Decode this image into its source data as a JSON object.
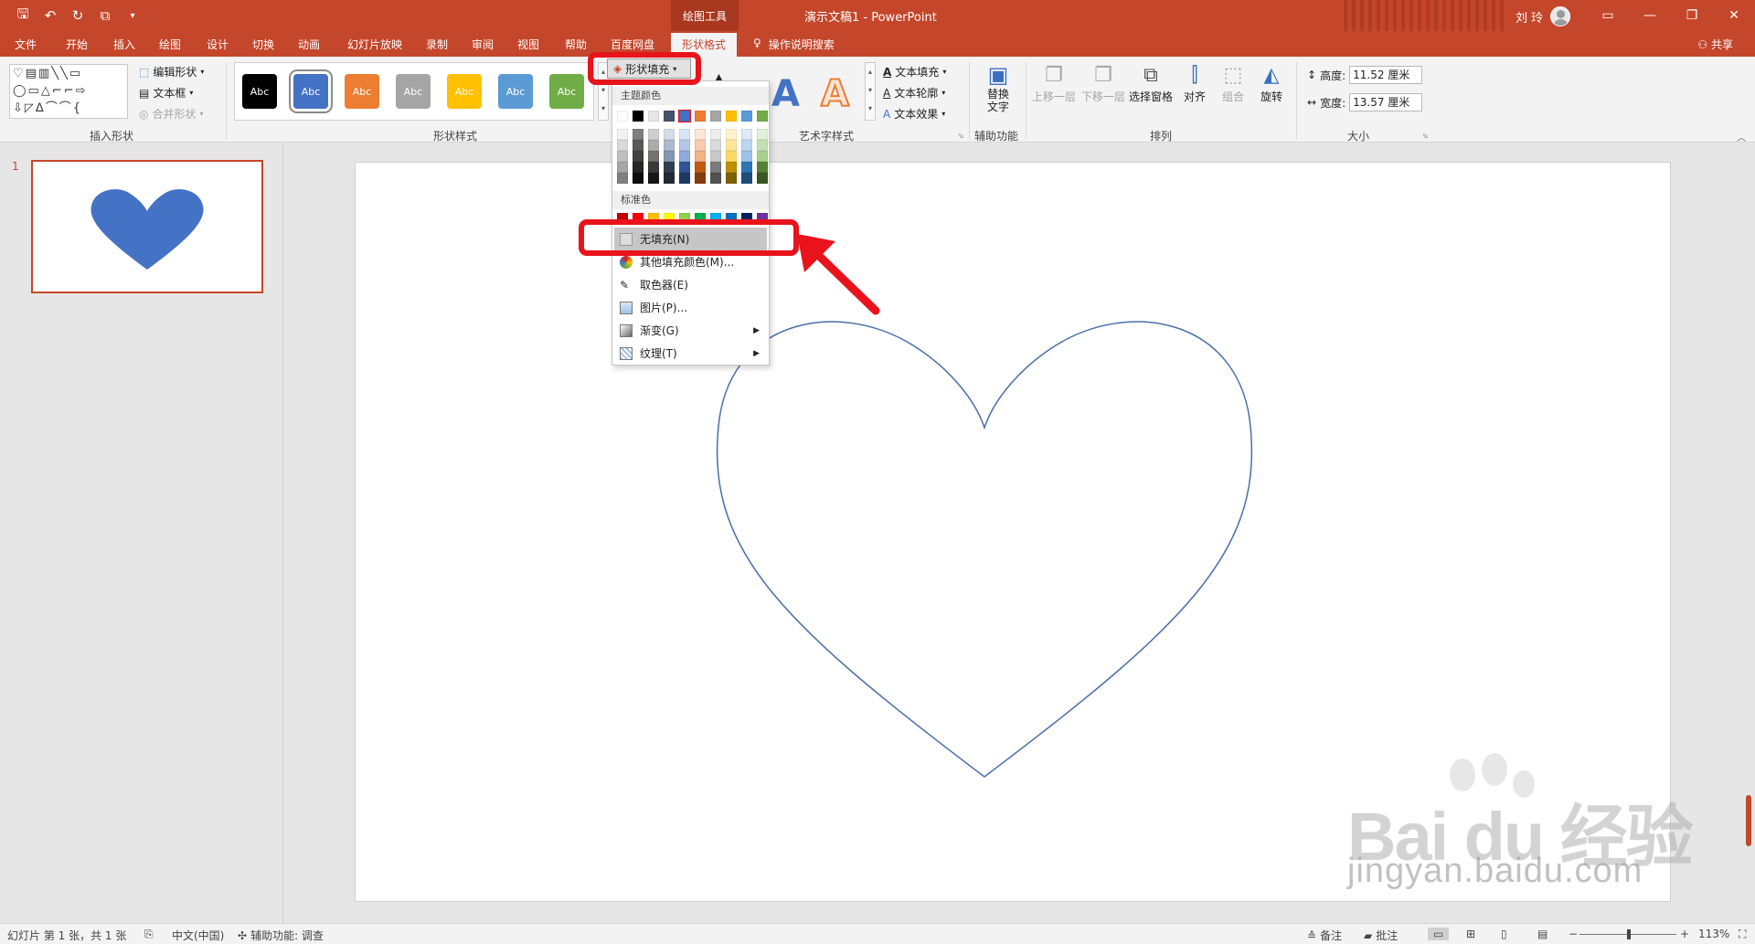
{
  "window": {
    "title": "演示文稿1 - PowerPoint",
    "context_tab": "绘图工具",
    "user": "刘 玲"
  },
  "tabs": [
    "文件",
    "开始",
    "插入",
    "绘图",
    "设计",
    "切换",
    "动画",
    "幻灯片放映",
    "录制",
    "审阅",
    "视图",
    "帮助",
    "百度网盘",
    "形状格式"
  ],
  "active_tab": "形状格式",
  "search_label": "操作说明搜索",
  "share_label": "共享",
  "ribbon": {
    "insert_shapes": {
      "label": "插入形状",
      "edit_shape": "编辑形状",
      "text_box": "文本框",
      "merge_shapes": "合并形状"
    },
    "shape_styles": {
      "label": "形状样式",
      "swatch_text": "Abc",
      "swatches": [
        "#000000",
        "#4472c4",
        "#ed7d31",
        "#a5a5a5",
        "#ffc000",
        "#5b9bd5",
        "#70ad47"
      ],
      "selected_index": 1,
      "fill_button": "形状填充"
    },
    "wordart": {
      "label": "艺术字样式",
      "letter": "A",
      "text_fill": "文本填充",
      "text_outline": "文本轮廓",
      "text_effects": "文本效果"
    },
    "accessibility": {
      "label": "辅助功能",
      "alt_text_line1": "替换",
      "alt_text_line2": "文字"
    },
    "arrange": {
      "label": "排列",
      "bring_forward": "上移一层",
      "send_backward": "下移一层",
      "selection_pane": "选择窗格",
      "align": "对齐",
      "group": "组合",
      "rotate": "旋转"
    },
    "size": {
      "label": "大小",
      "height_label": "高度:",
      "height_value": "11.52 厘米",
      "width_label": "宽度:",
      "width_value": "13.57 厘米"
    }
  },
  "fill_menu": {
    "theme_colors_header": "主题颜色",
    "theme_colors": [
      "#ffffff",
      "#000000",
      "#e7e6e6",
      "#44546a",
      "#4472c4",
      "#ed7d31",
      "#a5a5a5",
      "#ffc000",
      "#5b9bd5",
      "#70ad47"
    ],
    "theme_shades": [
      [
        "#f2f2f2",
        "#d9d9d9",
        "#bfbfbf",
        "#a6a6a6",
        "#808080"
      ],
      [
        "#7f7f7f",
        "#595959",
        "#404040",
        "#262626",
        "#0d0d0d"
      ],
      [
        "#d0cece",
        "#aeabab",
        "#757171",
        "#3b3838",
        "#171616"
      ],
      [
        "#d6dce5",
        "#adb9ca",
        "#8497b0",
        "#333f50",
        "#222a35"
      ],
      [
        "#dae3f3",
        "#b4c7e7",
        "#8faadc",
        "#2f5597",
        "#1f3864"
      ],
      [
        "#fbe5d6",
        "#f8cbad",
        "#f4b183",
        "#c55a11",
        "#843c0c"
      ],
      [
        "#ededed",
        "#dbdbdb",
        "#c9c9c9",
        "#7b7b7b",
        "#525252"
      ],
      [
        "#fff2cc",
        "#ffe699",
        "#ffd966",
        "#bf9000",
        "#7f6000"
      ],
      [
        "#deebf7",
        "#bdd7ee",
        "#9dc3e6",
        "#2e75b6",
        "#1f4e79"
      ],
      [
        "#e2f0d9",
        "#c5e0b4",
        "#a9d18e",
        "#548235",
        "#385723"
      ]
    ],
    "standard_colors_header": "标准色",
    "standard_colors": [
      "#c00000",
      "#ff0000",
      "#ffc000",
      "#ffff00",
      "#92d050",
      "#00b050",
      "#00b0f0",
      "#0070c0",
      "#002060",
      "#7030a0"
    ],
    "items": [
      {
        "label": "无填充(N)"
      },
      {
        "label": "其他填充颜色(M)..."
      },
      {
        "label": "取色器(E)"
      },
      {
        "label": "图片(P)..."
      },
      {
        "label": "渐变(G)"
      },
      {
        "label": "纹理(T)"
      }
    ]
  },
  "thumbnails": {
    "slide_number": "1"
  },
  "shape": {
    "fill": "#4472c4",
    "outline": "#4a6fa8"
  },
  "status_bar": {
    "slide_info": "幻灯片 第 1 张，共 1 张",
    "language": "中文(中国)",
    "accessibility": "辅助功能: 调查",
    "notes": "备注",
    "comments": "批注",
    "zoom": "113%"
  },
  "annotation_color": "#e8131b",
  "watermark": {
    "big": "Bai du 经验",
    "url": "jingyan.baidu.com"
  }
}
